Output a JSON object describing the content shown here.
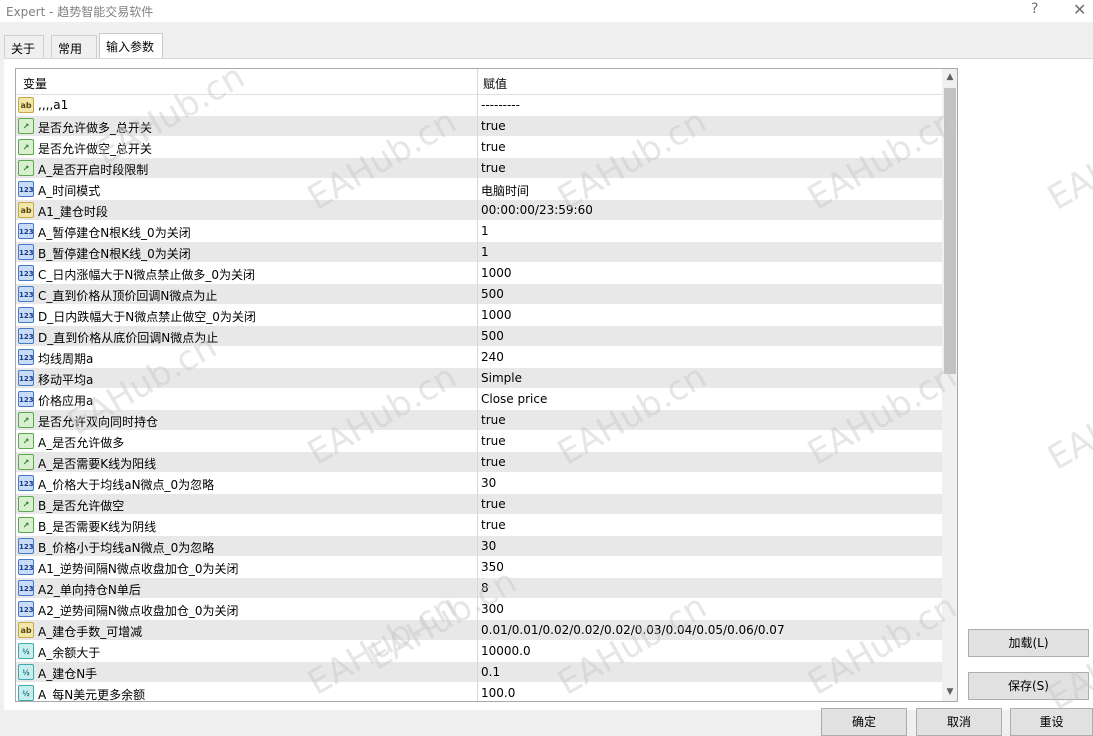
{
  "window": {
    "title": "Expert - 趋势智能交易软件",
    "help": "?",
    "close": "✕"
  },
  "tabs": [
    {
      "label": "关于"
    },
    {
      "label": "常用"
    },
    {
      "label": "输入参数"
    }
  ],
  "grid": {
    "headers": {
      "name": "变量",
      "value": "赋值"
    },
    "rows": [
      {
        "icon": "ab",
        "name": ",,,,a1",
        "value": "---------"
      },
      {
        "icon": "bool",
        "name": "是否允许做多_总开关",
        "value": "true"
      },
      {
        "icon": "bool",
        "name": "是否允许做空_总开关",
        "value": "true"
      },
      {
        "icon": "bool",
        "name": "A_是否开启时段限制",
        "value": "true"
      },
      {
        "icon": "int",
        "name": "A_时间模式",
        "value": "电脑时间"
      },
      {
        "icon": "ab",
        "name": "A1_建仓时段",
        "value": "00:00:00/23:59:60"
      },
      {
        "icon": "int",
        "name": "A_暂停建仓N根K线_0为关闭",
        "value": "1"
      },
      {
        "icon": "int",
        "name": "B_暂停建仓N根K线_0为关闭",
        "value": "1"
      },
      {
        "icon": "int",
        "name": "C_日内涨幅大于N微点禁止做多_0为关闭",
        "value": "1000"
      },
      {
        "icon": "int",
        "name": "C_直到价格从顶价回调N微点为止",
        "value": "500"
      },
      {
        "icon": "int",
        "name": "D_日内跌幅大于N微点禁止做空_0为关闭",
        "value": "1000"
      },
      {
        "icon": "int",
        "name": "D_直到价格从底价回调N微点为止",
        "value": "500"
      },
      {
        "icon": "int",
        "name": "均线周期a",
        "value": "240"
      },
      {
        "icon": "int",
        "name": "移动平均a",
        "value": "Simple"
      },
      {
        "icon": "int",
        "name": "价格应用a",
        "value": "Close price"
      },
      {
        "icon": "bool",
        "name": "是否允许双向同时持仓",
        "value": "true"
      },
      {
        "icon": "bool",
        "name": "A_是否允许做多",
        "value": "true"
      },
      {
        "icon": "bool",
        "name": "A_是否需要K线为阳线",
        "value": "true"
      },
      {
        "icon": "int",
        "name": "A_价格大于均线aN微点_0为忽略",
        "value": "30"
      },
      {
        "icon": "bool",
        "name": "B_是否允许做空",
        "value": "true"
      },
      {
        "icon": "bool",
        "name": "B_是否需要K线为阴线",
        "value": "true"
      },
      {
        "icon": "int",
        "name": "B_价格小于均线aN微点_0为忽略",
        "value": "30"
      },
      {
        "icon": "int",
        "name": "A1_逆势间隔N微点收盘加仓_0为关闭",
        "value": "350"
      },
      {
        "icon": "int",
        "name": "A2_单向持仓N单后",
        "value": "8"
      },
      {
        "icon": "int",
        "name": "A2_逆势间隔N微点收盘加仓_0为关闭",
        "value": "300"
      },
      {
        "icon": "ab",
        "name": "A_建仓手数_可增减",
        "value": "0.01/0.01/0.02/0.02/0.02/0.03/0.04/0.05/0.06/0.07"
      },
      {
        "icon": "dbl",
        "name": "A_余额大于",
        "value": "10000.0"
      },
      {
        "icon": "dbl",
        "name": "A_建仓N手",
        "value": "0.1"
      },
      {
        "icon": "dbl",
        "name": "A_每N美元更多余额",
        "value": "100.0"
      }
    ]
  },
  "icons": {
    "ab": "ab",
    "bool": "↗",
    "int": "123",
    "dbl": "½"
  },
  "buttons": {
    "load": "加载(L)",
    "save": "保存(S)",
    "ok": "确定",
    "cancel": "取消",
    "reset": "重设"
  },
  "watermark": "EAHub.cn"
}
